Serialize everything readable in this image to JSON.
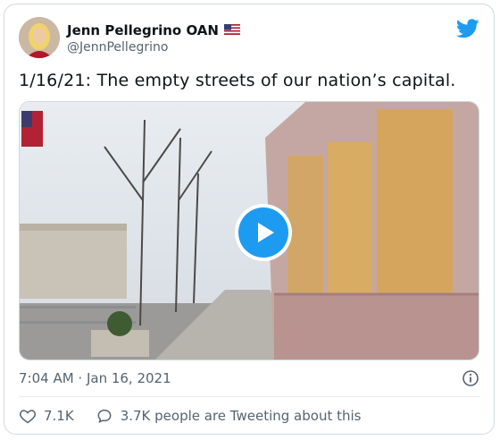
{
  "author": {
    "display_name": "Jenn Pellegrino OAN",
    "handle": "@JennPellegrino",
    "flag_icon": "us-flag-icon"
  },
  "tweet": {
    "text": "1/16/21: The empty streets of our nation’s capital.",
    "timestamp": "7:04 AM · Jan 16, 2021"
  },
  "actions": {
    "likes": "7.1K",
    "conversation": "3.7K people are Tweeting about this"
  },
  "colors": {
    "accent": "#1d9bf0",
    "muted": "#536471",
    "text": "#0f1419",
    "border": "#cfd9de"
  }
}
